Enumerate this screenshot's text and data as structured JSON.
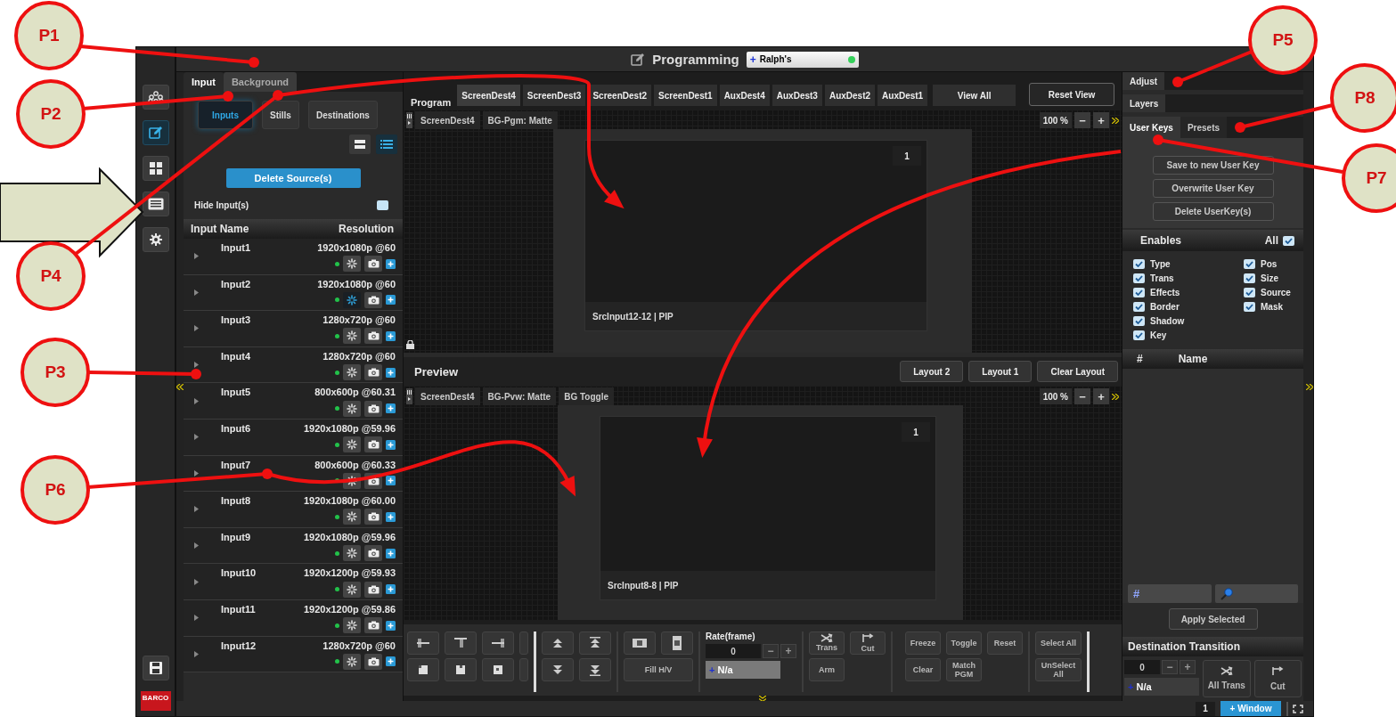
{
  "window": {
    "title": "Programming",
    "preset": {
      "icon": "+",
      "label": "Ralph's"
    }
  },
  "sidebar": {
    "items": [
      {
        "kind": "nodes",
        "selected": false
      },
      {
        "kind": "edit",
        "selected": true
      },
      {
        "kind": "grid",
        "selected": false
      },
      {
        "kind": "keyboard",
        "selected": false
      },
      {
        "kind": "gear",
        "selected": false
      }
    ],
    "logo": "BARCO"
  },
  "left_panel": {
    "tabs": [
      {
        "label": "Input",
        "selected": true
      },
      {
        "label": "Background",
        "selected": false
      }
    ],
    "subtabs": [
      {
        "label": "Inputs",
        "selected": true
      },
      {
        "label": "Stills",
        "selected": false
      },
      {
        "label": "Destinations",
        "selected": false
      }
    ],
    "view_modes": [
      {
        "kind": "compact",
        "selected": false
      },
      {
        "kind": "detail",
        "selected": true
      }
    ],
    "delete_button": "Delete Source(s)",
    "hide_inputs": {
      "label": "Hide Input(s)",
      "checked": false
    },
    "table": {
      "columns": [
        "Input Name",
        "Resolution"
      ],
      "rows": [
        {
          "name": "Input1",
          "resolution": "1920x1080p @60",
          "frozen": false
        },
        {
          "name": "Input2",
          "resolution": "1920x1080p @60",
          "frozen": true
        },
        {
          "name": "Input3",
          "resolution": "1280x720p @60",
          "frozen": false
        },
        {
          "name": "Input4",
          "resolution": "1280x720p @60",
          "frozen": false
        },
        {
          "name": "Input5",
          "resolution": "800x600p @60.31",
          "frozen": false
        },
        {
          "name": "Input6",
          "resolution": "1920x1080p @59.96",
          "frozen": false
        },
        {
          "name": "Input7",
          "resolution": "800x600p @60.33",
          "frozen": false
        },
        {
          "name": "Input8",
          "resolution": "1920x1080p @60.00",
          "frozen": false
        },
        {
          "name": "Input9",
          "resolution": "1920x1080p @59.96",
          "frozen": false
        },
        {
          "name": "Input10",
          "resolution": "1920x1200p @59.93",
          "frozen": false
        },
        {
          "name": "Input11",
          "resolution": "1920x1200p @59.86",
          "frozen": false
        },
        {
          "name": "Input12",
          "resolution": "1280x720p @60",
          "frozen": false
        }
      ]
    }
  },
  "program": {
    "label": "Program",
    "tabs": [
      {
        "label": "ScreenDest4",
        "selected": true
      },
      {
        "label": "ScreenDest3",
        "selected": false
      },
      {
        "label": "ScreenDest2",
        "selected": false
      },
      {
        "label": "ScreenDest1",
        "selected": false
      },
      {
        "label": "AuxDest4",
        "selected": false
      },
      {
        "label": "AuxDest3",
        "selected": false
      },
      {
        "label": "AuxDest2",
        "selected": false
      },
      {
        "label": "AuxDest1",
        "selected": false
      }
    ],
    "view_all": "View All",
    "reset": "Reset View",
    "tags": [
      "ScreenDest4",
      "BG-Pgm: Matte"
    ],
    "zoom": "100 %",
    "zoom_out": "−",
    "zoom_in": "+",
    "layer": {
      "number": "1",
      "caption": "SrcInput12-12 | PIP"
    }
  },
  "preview": {
    "label": "Preview",
    "buttons": [
      "Layout 2",
      "Layout 1",
      "Clear Layout"
    ],
    "tags": [
      "ScreenDest4",
      "BG-Pvw: Matte",
      "BG Toggle"
    ],
    "zoom": "100 %",
    "zoom_out": "−",
    "zoom_in": "+",
    "layer": {
      "number": "1",
      "caption": "SrcInput8-8 | PIP"
    }
  },
  "toolbar": {
    "fill": "Fill H/V",
    "rate": {
      "label": "Rate(frame)",
      "value": "0",
      "minus": "−",
      "plus": "+"
    },
    "transition": {
      "icon": "+",
      "label": "N/a"
    },
    "trans": "Trans",
    "cut": "Cut",
    "arm": "Arm",
    "freeze": "Freeze",
    "toggle": "Toggle",
    "reset": "Reset",
    "clear": "Clear",
    "match": "Match PGM",
    "select_all": "Select All",
    "unselect_all": "UnSelect All"
  },
  "right_panel": {
    "tabs": [
      "Adjust",
      "Layers"
    ],
    "key_tabs": [
      {
        "label": "User Keys",
        "selected": true
      },
      {
        "label": "Presets",
        "selected": false
      }
    ],
    "key_buttons": [
      "Save to new User Key",
      "Overwrite User Key",
      "Delete UserKey(s)"
    ],
    "enables": {
      "title": "Enables",
      "all_label": "All",
      "all_checked": true,
      "items": [
        {
          "label": "Type",
          "checked": true
        },
        {
          "label": "Trans",
          "checked": true
        },
        {
          "label": "Effects",
          "checked": true
        },
        {
          "label": "Border",
          "checked": true
        },
        {
          "label": "Shadow",
          "checked": true
        },
        {
          "label": "Key",
          "checked": true
        },
        {
          "label": "Pos",
          "checked": true
        },
        {
          "label": "Size",
          "checked": true
        },
        {
          "label": "Source",
          "checked": true
        },
        {
          "label": "Mask",
          "checked": true
        }
      ]
    },
    "list_columns": [
      "#",
      "Name"
    ],
    "number_field": "#",
    "apply": "Apply Selected",
    "destination_transition": {
      "title": "Destination Transition",
      "value": "0",
      "minus": "−",
      "plus": "+",
      "transition": {
        "icon": "+",
        "label": "N/a"
      },
      "all_trans": "All Trans",
      "cut": "Cut"
    }
  },
  "status_bar": {
    "page": "1",
    "add_window": "+ Window"
  },
  "annotations": [
    {
      "label": "P1"
    },
    {
      "label": "P2"
    },
    {
      "label": "P4"
    },
    {
      "label": "P3"
    },
    {
      "label": "P6"
    },
    {
      "label": "P5"
    },
    {
      "label": "P8"
    },
    {
      "label": "P7"
    }
  ]
}
